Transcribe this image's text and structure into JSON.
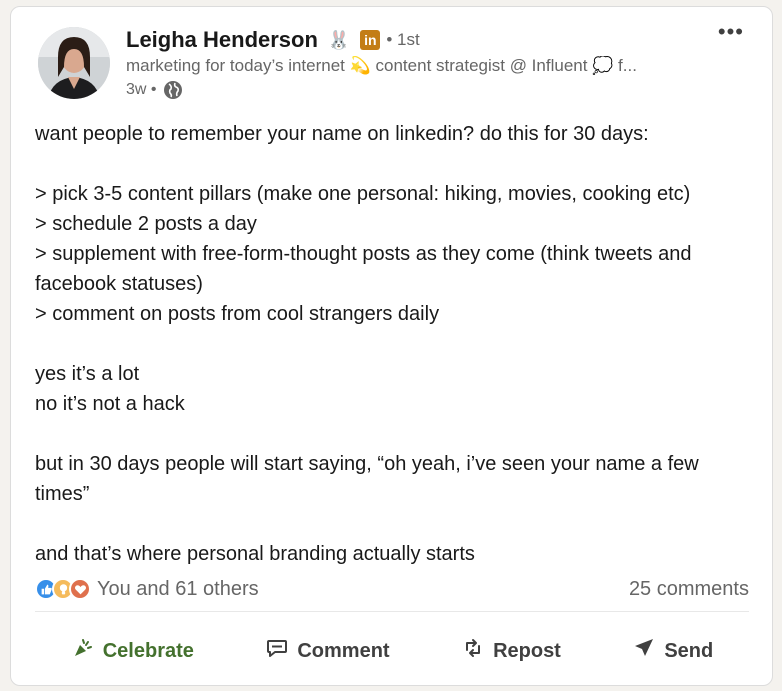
{
  "author": {
    "name": "Leigha Henderson",
    "name_emoji": "🐰",
    "linkedin_badge": "in",
    "degree": "• 1st",
    "headline": "marketing for today’s internet 💫 content strategist @ Influent 💭 f...",
    "age": "3w •",
    "visibility_icon": "globe-icon"
  },
  "post": {
    "lines": [
      "want people to remember your name on linkedin? do this for 30 days:",
      "",
      "> pick 3-5 content pillars (make one personal: hiking, movies, cooking etc)",
      "> schedule 2 posts a day",
      "> supplement with free-form-thought posts as they come (think tweets and facebook statuses)",
      "> comment on posts from cool strangers daily",
      "",
      "yes it’s a lot",
      "no it’s not a hack",
      "",
      "but in 30 days people will start saying, “oh yeah, i’ve seen your name a few times”",
      "",
      "and that’s where personal branding actually starts"
    ]
  },
  "social": {
    "reactions_text": "You and 61 others",
    "comments_text": "25 comments",
    "reaction_icons": [
      "like-icon",
      "insightful-icon",
      "love-icon"
    ]
  },
  "actions": {
    "celebrate": "Celebrate",
    "comment": "Comment",
    "repost": "Repost",
    "send": "Send"
  },
  "colors": {
    "celebrate_active": "#44712e",
    "like": "#378fe9",
    "insightful": "#f5bb5c",
    "love": "#df704d",
    "linkedin_badge": "#c37d16"
  }
}
